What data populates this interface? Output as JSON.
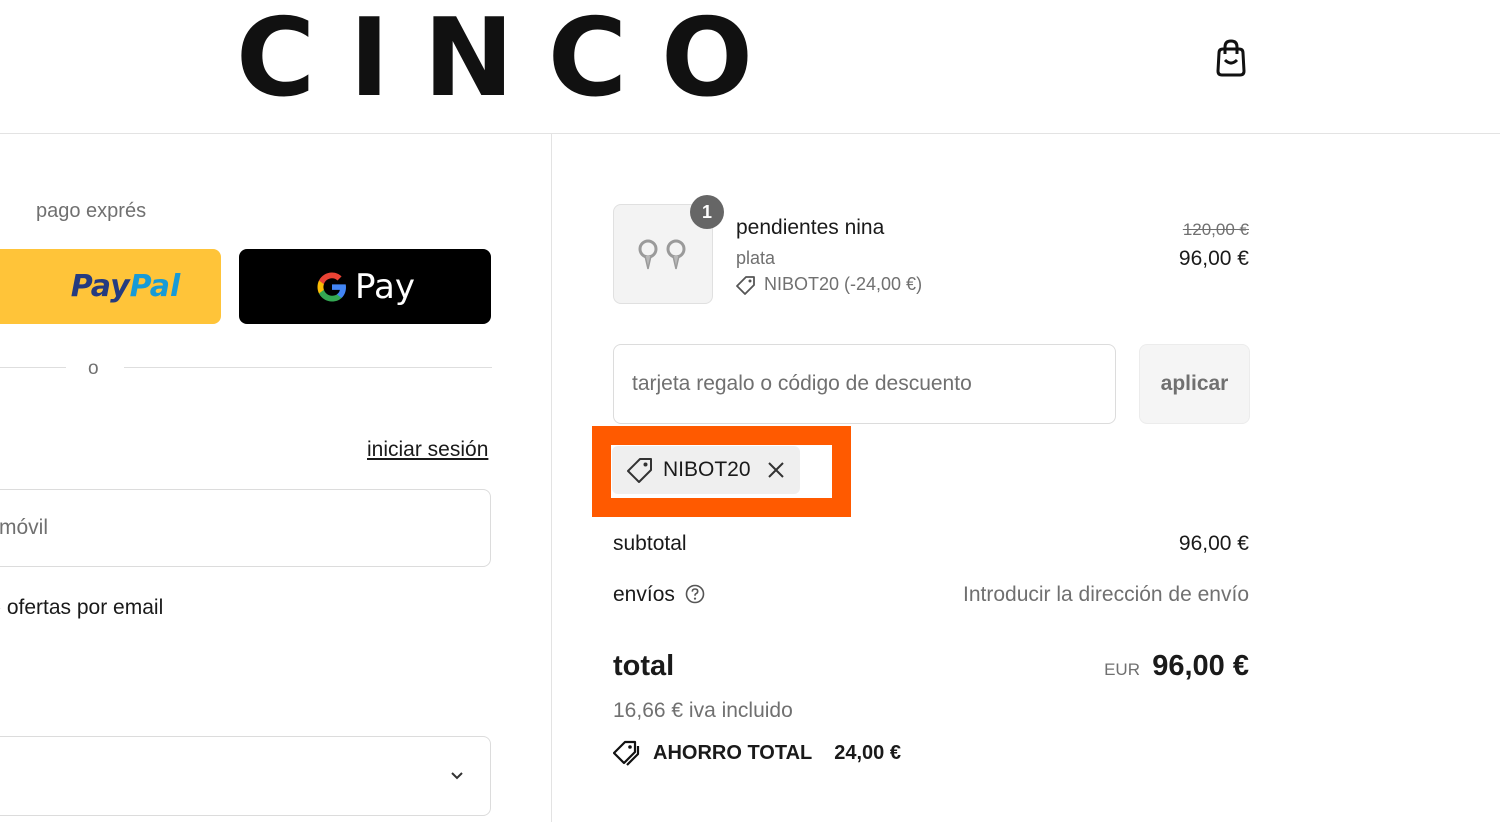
{
  "header": {
    "logo": "CINCO"
  },
  "express_checkout": {
    "label": "pago exprés",
    "paypal": {
      "text_a": "Pay",
      "text_b": "Pal"
    },
    "gpay": {
      "g": "G",
      "text": "Pay"
    },
    "divider": "o"
  },
  "contact": {
    "login_link": "iniciar sesión",
    "input_visible_text": "móvil",
    "offers_text": "ofertas por email"
  },
  "order": {
    "item": {
      "quantity": "1",
      "name": "pendientes nina",
      "variant": "plata",
      "discount": "NIBOT20 (-24,00 €)",
      "price_original": "120,00 €",
      "price_final": "96,00 €"
    },
    "discount_input": {
      "placeholder": "tarjeta regalo o código de descuento"
    },
    "apply_label": "aplicar",
    "applied_code": "NIBOT20",
    "subtotal": {
      "label": "subtotal",
      "value": "96,00 €"
    },
    "shipping": {
      "label": "envíos",
      "value": "Introducir la dirección de envío"
    },
    "total": {
      "label": "total",
      "currency": "EUR",
      "value": "96,00 €"
    },
    "tax_note": "16,66 € iva incluido",
    "savings": {
      "label": "AHORRO TOTAL",
      "value": "24,00 €"
    }
  },
  "colors": {
    "highlight": "#ff5a00",
    "paypal_yellow": "#ffc439",
    "paypal_dark_blue": "#253b80",
    "paypal_light_blue": "#179bd7",
    "gpay_black": "#000000",
    "muted_text": "#707070"
  },
  "icons": [
    "shopping-bag-icon",
    "earrings-image",
    "tag-icon",
    "close-icon",
    "help-icon",
    "chevron-down-icon",
    "savings-tag-icon"
  ]
}
